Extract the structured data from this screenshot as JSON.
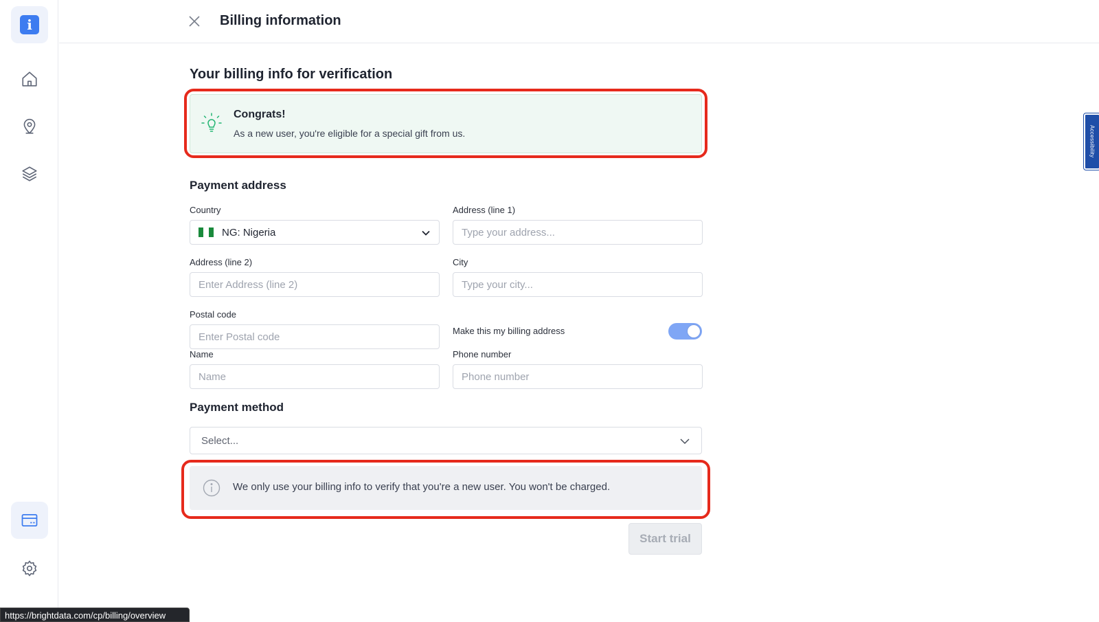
{
  "sidebar": {
    "logo_letter": "i",
    "items": [
      {
        "name": "home",
        "icon": "home-icon"
      },
      {
        "name": "location",
        "icon": "map-pin-icon"
      },
      {
        "name": "layers",
        "icon": "layers-icon"
      },
      {
        "name": "billing",
        "icon": "credit-card-icon",
        "active": true
      },
      {
        "name": "settings",
        "icon": "gear-icon"
      }
    ]
  },
  "header": {
    "title": "Billing information"
  },
  "main": {
    "section_title": "Your billing info for verification",
    "congrats": {
      "title": "Congrats!",
      "text": "As a new user, you're eligible for a special gift from us."
    },
    "payment_address_title": "Payment address",
    "fields": {
      "country": {
        "label": "Country",
        "value": "NG: Nigeria"
      },
      "address1": {
        "label": "Address (line 1)",
        "placeholder": "Type your address..."
      },
      "address2": {
        "label": "Address (line 2)",
        "placeholder": "Enter Address (line 2)"
      },
      "city": {
        "label": "City",
        "placeholder": "Type your city..."
      },
      "postal": {
        "label": "Postal code",
        "placeholder": "Enter Postal code"
      },
      "billing_toggle": {
        "label": "Make this my billing address",
        "on": true
      },
      "name": {
        "label": "Name",
        "placeholder": "Name"
      },
      "phone": {
        "label": "Phone number",
        "placeholder": "Phone number"
      }
    },
    "payment_method_title": "Payment method",
    "payment_method_select": "Select...",
    "info_text": "We only use your billing info to verify that you're a new user. You won't be charged.",
    "start_button": "Start trial"
  },
  "accessibility_tab": "Accessibility",
  "status_url": "https://brightdata.com/cp/billing/overview",
  "colors": {
    "accent": "#3d7cf0",
    "toggle_on": "#7fa6f5",
    "highlight_outline": "#e62a1c",
    "congrats_bg": "#eff8f3",
    "nigeria_green": "#1a8a3c"
  }
}
